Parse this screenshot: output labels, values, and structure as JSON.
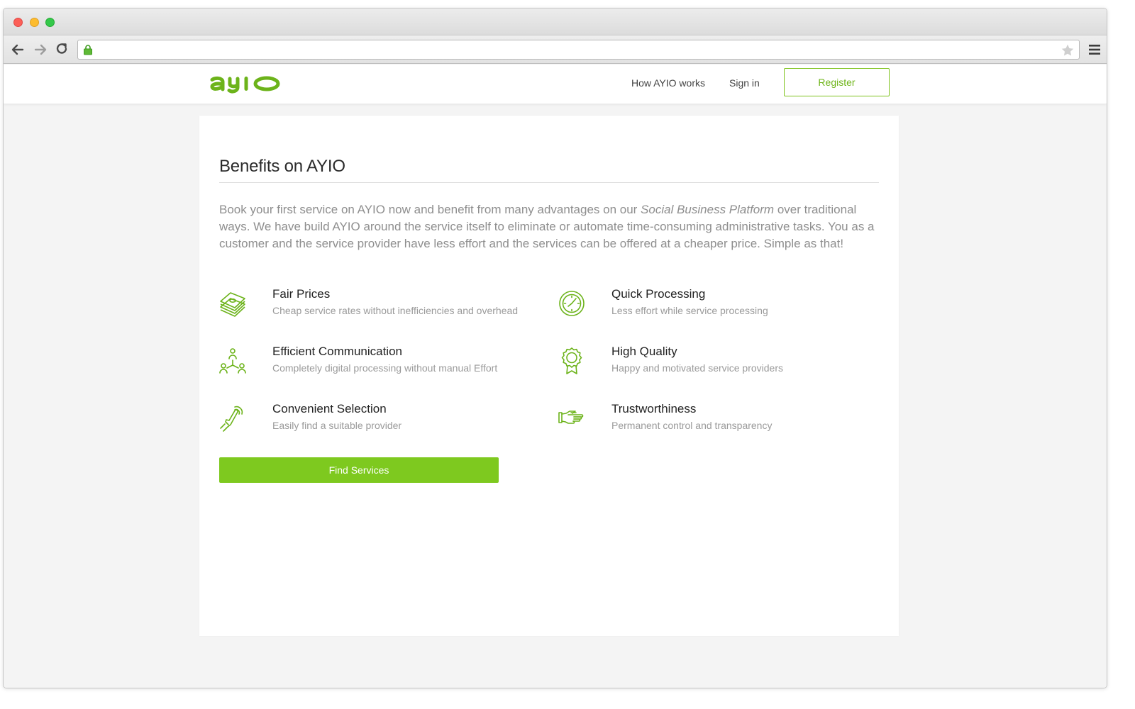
{
  "browser": {
    "url": ""
  },
  "header": {
    "logo_text": "ayio",
    "nav": {
      "how_label": "How AYIO works",
      "signin_label": "Sign in",
      "register_label": "Register"
    }
  },
  "main": {
    "title": "Benefits on AYIO",
    "intro_before": "Book your first service on AYIO now and benefit from many advantages on our ",
    "intro_em": "Social Business Platform",
    "intro_after": " over traditional ways. We have build AYIO around the service itself to eliminate or automate time-consuming administrative tasks. You as a customer and the service provider have less effort and the services can be offered at a cheaper price. Simple as that!",
    "benefits": [
      {
        "title": "Fair Prices",
        "desc": "Cheap service rates without inefficiencies and overhead",
        "icon": "money-stack-icon"
      },
      {
        "title": "Quick Processing",
        "desc": "Less effort while service processing",
        "icon": "clock-icon"
      },
      {
        "title": "Efficient Communication",
        "desc": "Completely digital processing without manual Effort",
        "icon": "people-network-icon"
      },
      {
        "title": "High Quality",
        "desc": "Happy and motivated service providers",
        "icon": "award-badge-icon"
      },
      {
        "title": "Convenient Selection",
        "desc": "Easily find a suitable provider",
        "icon": "touch-finger-icon"
      },
      {
        "title": "Trustworthiness",
        "desc": "Permanent control and transparency",
        "icon": "handshake-icon"
      }
    ],
    "cta_label": "Find Services"
  },
  "colors": {
    "brand_green": "#7ec91f",
    "text_dark": "#222222",
    "text_muted": "#9a9a9a"
  }
}
